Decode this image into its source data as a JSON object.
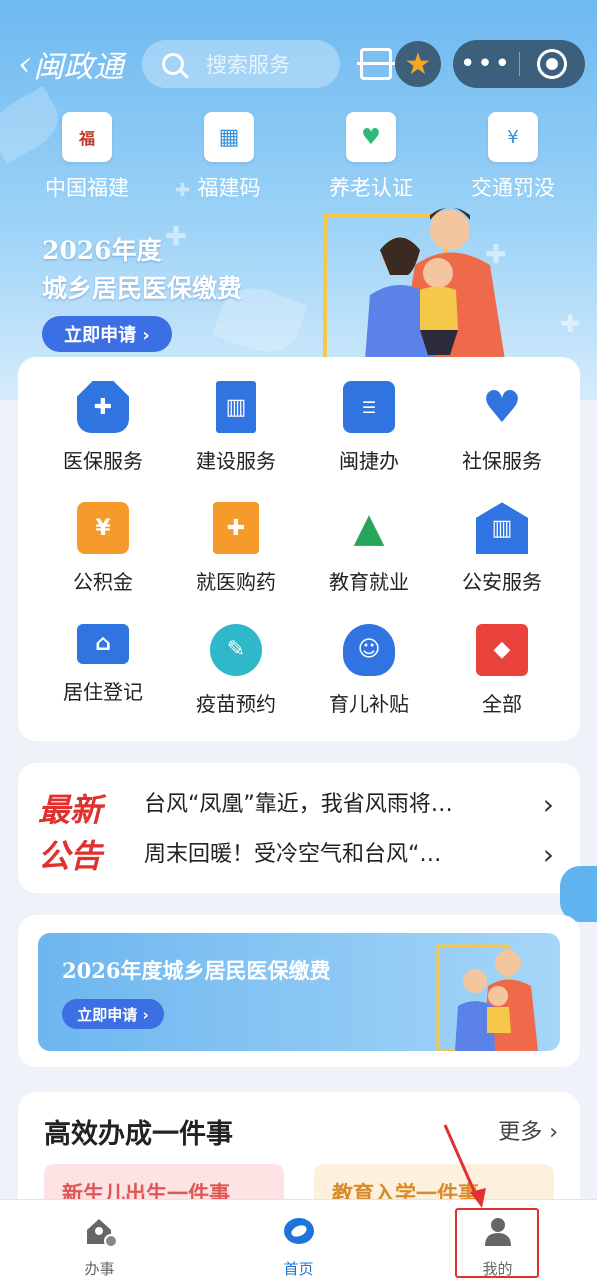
{
  "header": {
    "app_title": "闽政通",
    "search_placeholder": "搜索服务"
  },
  "quick_links": [
    {
      "label": "中国福建",
      "icon": "fujian-seal-icon"
    },
    {
      "label": "福建码",
      "icon": "qr-code-icon"
    },
    {
      "label": "养老认证",
      "icon": "pension-verify-icon"
    },
    {
      "label": "交通罚没",
      "icon": "traffic-fine-icon"
    }
  ],
  "banner": {
    "title_line1": "2026年度",
    "title_line2": "城乡居民医保缴费",
    "apply_label": "立即申请 ›"
  },
  "services": [
    {
      "label": "医保服务",
      "icon": "medical-insurance-icon",
      "color": "#2f74e0"
    },
    {
      "label": "建设服务",
      "icon": "building-icon",
      "color": "#2f74e0"
    },
    {
      "label": "闽捷办",
      "icon": "min-jie-ban-icon",
      "color": "#2f74e0"
    },
    {
      "label": "社保服务",
      "icon": "social-security-icon",
      "color": "#2f74e0"
    },
    {
      "label": "公积金",
      "icon": "housing-fund-icon",
      "color": "#f59b2c"
    },
    {
      "label": "就医购药",
      "icon": "hospital-icon",
      "color": "#f59b2c"
    },
    {
      "label": "教育就业",
      "icon": "graduation-cap-icon",
      "color": "#27a55a"
    },
    {
      "label": "公安服务",
      "icon": "public-security-icon",
      "color": "#2f74e0"
    },
    {
      "label": "居住登记",
      "icon": "residence-card-icon",
      "color": "#2f74e0"
    },
    {
      "label": "疫苗预约",
      "icon": "vaccine-icon",
      "color": "#2fb8c9"
    },
    {
      "label": "育儿补贴",
      "icon": "childcare-subsidy-icon",
      "color": "#2f74e0"
    },
    {
      "label": "全部",
      "icon": "all-services-icon",
      "color": "#e8423a"
    }
  ],
  "notice": {
    "tag_line1": "最新",
    "tag_line2": "公告",
    "items": [
      "台风“凤凰”靠近，我省风雨将…",
      "周末回暖！受冷空气和台风“…"
    ]
  },
  "promo": {
    "title": "2026年度城乡居民医保缴费",
    "apply_label": "立即申请 ›"
  },
  "efficient": {
    "title": "高效办成一件事",
    "more_label": "更多",
    "cards": [
      "新生儿出生一件事",
      "教育入学一件事"
    ]
  },
  "tabbar": [
    {
      "label": "办事",
      "icon": "affairs-icon"
    },
    {
      "label": "首页",
      "icon": "home-logo-icon"
    },
    {
      "label": "我的",
      "icon": "profile-icon"
    }
  ]
}
